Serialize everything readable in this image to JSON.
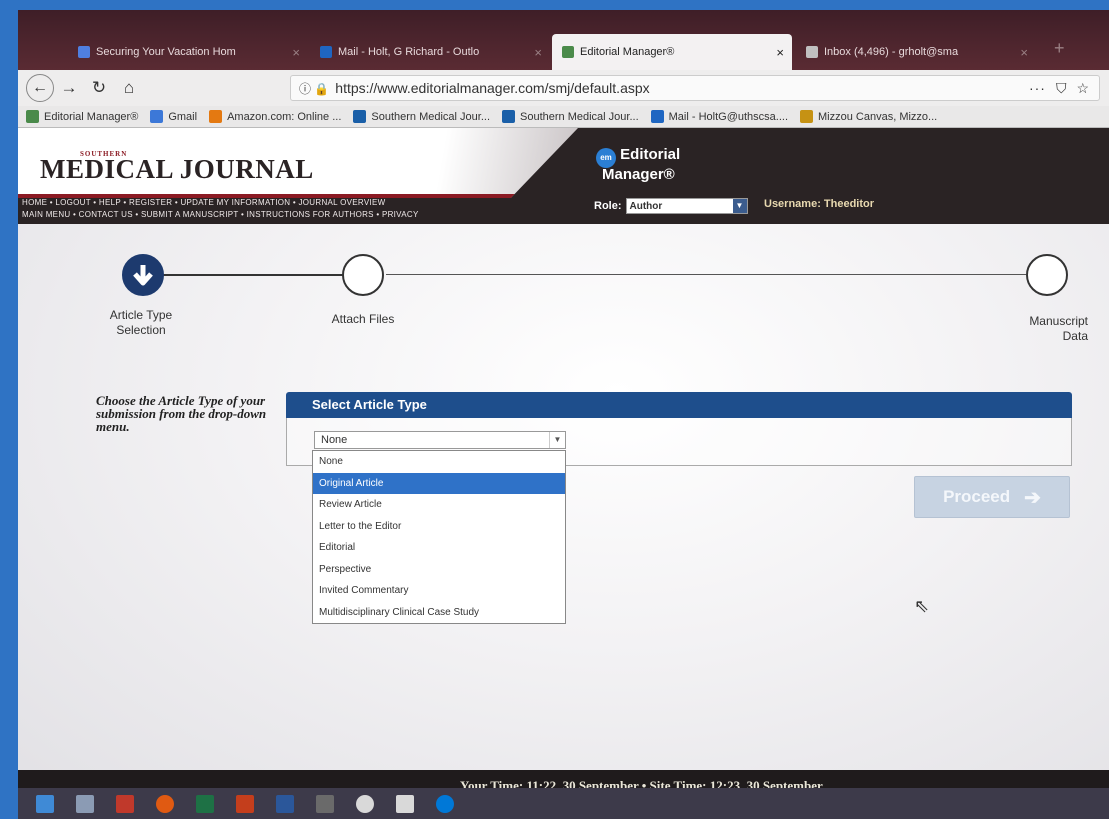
{
  "tabs": [
    {
      "label": "Securing Your Vacation Hom",
      "active": false,
      "icon_color": "#4f7fe0"
    },
    {
      "label": "Mail - Holt, G Richard - Outlo",
      "active": false,
      "icon_color": "#1f66c2"
    },
    {
      "label": "Editorial Manager®",
      "active": true,
      "icon_color": "#4a8a4a"
    },
    {
      "label": "Inbox (4,496) - grholt@sma",
      "active": false,
      "icon_color": "#c0c0c0"
    }
  ],
  "browser": {
    "url": "https://www.editorialmanager.com/smj/default.aspx",
    "more": "···"
  },
  "bookmarks": [
    {
      "label": "Editorial Manager®",
      "icon_color": "#4a8a4a"
    },
    {
      "label": "Gmail",
      "icon_color": "#3c78d8"
    },
    {
      "label": "Amazon.com: Online ...",
      "icon_color": "#e47911"
    },
    {
      "label": "Southern Medical Jour...",
      "icon_color": "#1a5fa8"
    },
    {
      "label": "Southern Medical Jour...",
      "icon_color": "#1a5fa8"
    },
    {
      "label": "Mail - HoltG@uthscsa....",
      "icon_color": "#1f66c2"
    },
    {
      "label": "Mizzou Canvas, Mizzo...",
      "icon_color": "#c69214"
    }
  ],
  "journal": {
    "small": "SOUTHERN",
    "name": "MEDICAL JOURNAL",
    "links_row1": "HOME • LOGOUT • HELP • REGISTER • UPDATE MY INFORMATION • JOURNAL OVERVIEW",
    "links_row2": "MAIN MENU • CONTACT US • SUBMIT A MANUSCRIPT • INSTRUCTIONS FOR AUTHORS • PRIVACY",
    "em_badge": "em",
    "em_line1": "Editorial",
    "em_line2": "Manager®",
    "role_label": "Role:",
    "role_value": "Author",
    "username": "Username: Theeditor"
  },
  "steps": [
    {
      "label_line1": "Article Type",
      "label_line2": "Selection",
      "active": true
    },
    {
      "label_line1": "Attach Files",
      "label_line2": "",
      "active": false
    },
    {
      "label_line1": "Manuscript",
      "label_line2": "Data",
      "active": false
    }
  ],
  "instructions": "Choose the Article Type of your submission from the drop-down menu.",
  "panel_title": "Select Article Type",
  "select": {
    "value": "None",
    "options": [
      "None",
      "Original Article",
      "Review Article",
      "Letter to the Editor",
      "Editorial",
      "Perspective",
      "Invited Commentary",
      "Multidisciplinary Clinical Case Study"
    ],
    "highlighted": "Original Article"
  },
  "proceed_label": "Proceed",
  "footer": "Your Time: 11:22, 30 September • Site Time: 12:23, 30 September",
  "taskbar_icons": [
    "#3f8ad6",
    "#8b9bb4",
    "#c0392b",
    "#e05a12",
    "#1e7145",
    "#c43e1c",
    "#2b579a",
    "#6a6a6a",
    "#d9d9d9",
    "#d9d9d9",
    "#0078d7"
  ]
}
